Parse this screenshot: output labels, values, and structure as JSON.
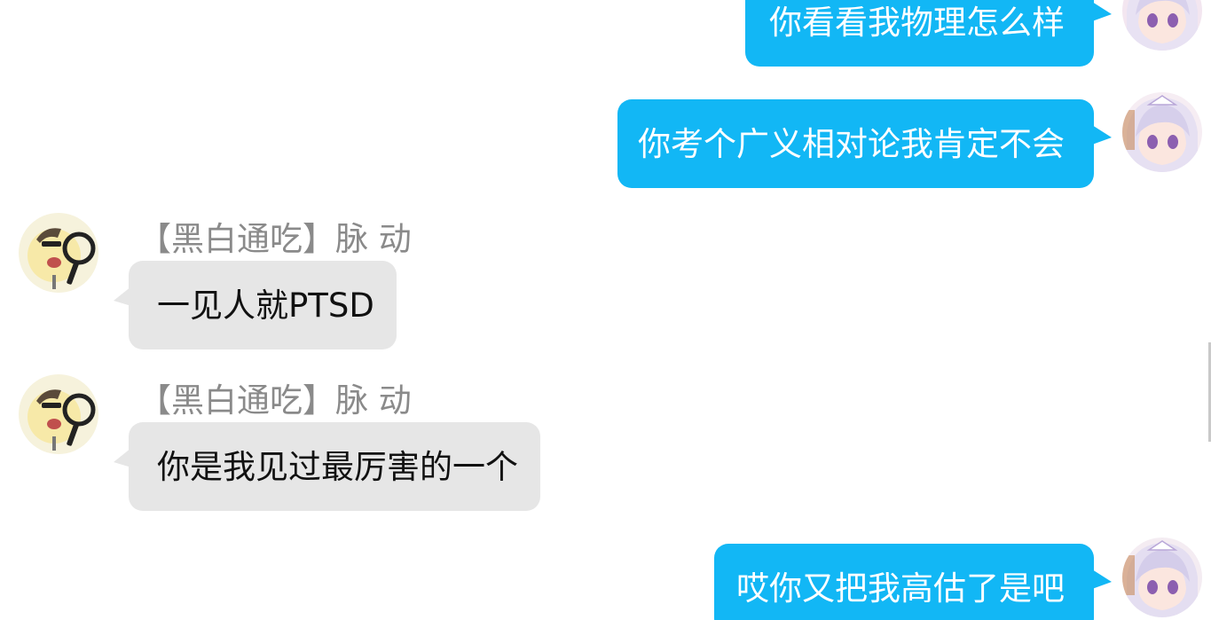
{
  "messages": [
    {
      "direction": "outgoing",
      "text": "你看看我物理怎么样",
      "avatar_icon": "anime-girl-avatar-icon"
    },
    {
      "direction": "outgoing",
      "text": "你考个广义相对论我肯定不会",
      "avatar_icon": "anime-girl-avatar-icon"
    },
    {
      "direction": "incoming",
      "sender": "【黑白通吃】脉 动",
      "text": "一见人就PTSD",
      "avatar_icon": "cartoon-magnifier-avatar-icon"
    },
    {
      "direction": "incoming",
      "sender": "【黑白通吃】脉 动",
      "text": "你是我见过最厉害的一个",
      "avatar_icon": "cartoon-magnifier-avatar-icon"
    },
    {
      "direction": "outgoing",
      "text": "哎你又把我高估了是吧",
      "avatar_icon": "anime-girl-avatar-icon"
    }
  ],
  "colors": {
    "outgoing_bubble": "#12b7f5",
    "incoming_bubble": "#e6e6e6",
    "sender_name": "#8a8a8a"
  }
}
